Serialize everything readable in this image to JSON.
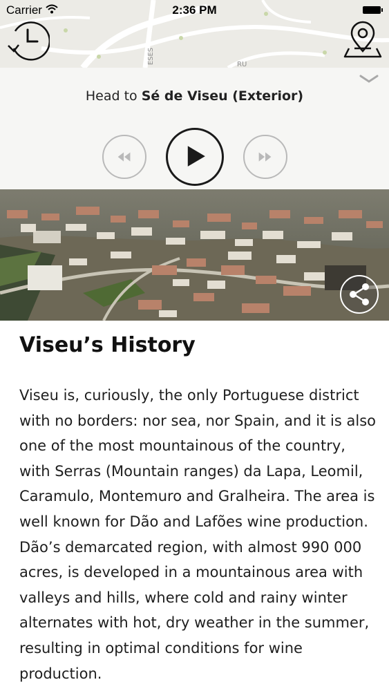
{
  "status_bar": {
    "carrier": "Carrier",
    "time": "2:36 PM"
  },
  "map": {
    "street_labels": [
      "ESES",
      "RU"
    ]
  },
  "player": {
    "head_prefix": "Head to",
    "destination": "Sé de Viseu (Exterior)"
  },
  "article": {
    "title": "Viseu’s History",
    "body": "Viseu is, curiously, the only Portuguese district with no borders: nor sea, nor Spain, and it is also one of the most mountainous of the country, with Serras (Mountain ranges) da Lapa, Leomil, Caramulo, Montemuro and Gralheira. The area is well known for Dão and Lafões wine production. Dão’s demarcated region, with almost 990 000 acres, is developed in a mountainous area with valleys and hills, where cold and rainy winter alternates with hot, dry weather in the summer, resulting in optimal conditions for wine production."
  },
  "icons": {
    "history": "clock-history-icon",
    "map": "map-pin-icon",
    "collapse": "chevron-down-icon",
    "rewind": "rewind-icon",
    "play": "play-icon",
    "fast_forward": "fast-forward-icon",
    "share": "share-icon"
  }
}
